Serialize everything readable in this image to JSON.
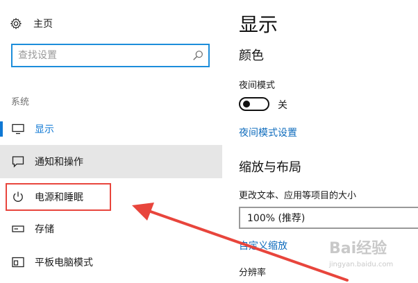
{
  "sidebar": {
    "home_label": "主页",
    "search_placeholder": "查找设置",
    "section_label": "系统",
    "items": [
      {
        "label": "显示",
        "icon": "monitor-icon",
        "state": "active"
      },
      {
        "label": "通知和操作",
        "icon": "message-icon",
        "state": "hover"
      },
      {
        "label": "电源和睡眠",
        "icon": "power-icon",
        "state": "highlighted"
      },
      {
        "label": "存储",
        "icon": "storage-icon",
        "state": "normal"
      },
      {
        "label": "平板电脑模式",
        "icon": "tablet-mode-icon",
        "state": "normal"
      }
    ]
  },
  "main": {
    "title": "显示",
    "color_heading": "颜色",
    "night_mode_label": "夜间模式",
    "night_mode_state": "关",
    "night_mode_settings_link": "夜间模式设置",
    "scale_heading": "缩放与布局",
    "text_size_label": "更改文本、应用等项目的大小",
    "scale_value": "100% (推荐)",
    "custom_scale_link": "自定义缩放",
    "resolution_label": "分辨率"
  },
  "watermark": {
    "brand": "Bai经验",
    "sub": "jingyan.baidu.com"
  },
  "colors": {
    "accent": "#0f78d4",
    "annotation": "#e8453c",
    "hover_bg": "#e6e6e6"
  }
}
